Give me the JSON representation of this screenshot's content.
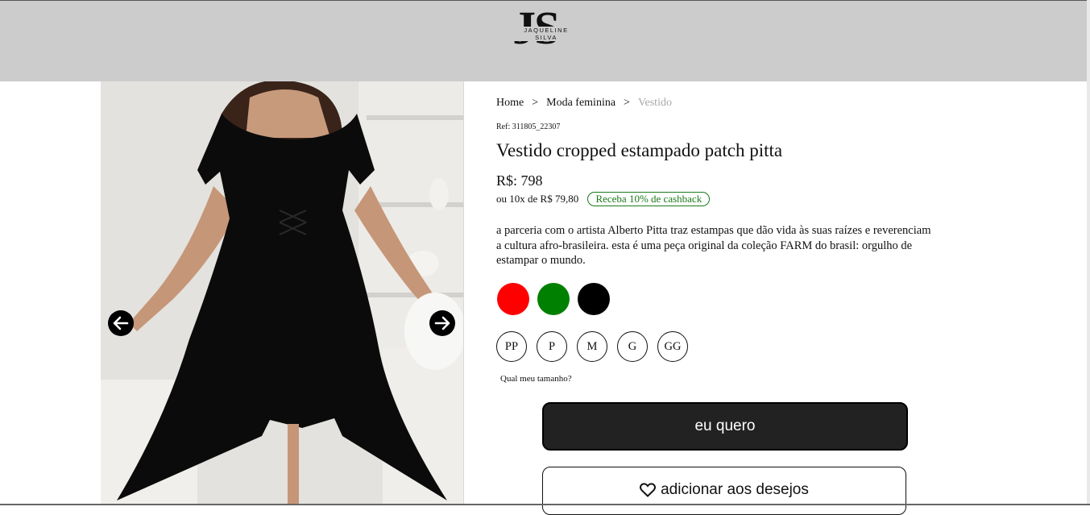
{
  "brand": {
    "logo_letters": "JS",
    "logo_name": "JAQUELINE SILVA"
  },
  "breadcrumb": {
    "items": [
      "Home",
      "Moda feminina",
      "Vestido"
    ],
    "separator": ">"
  },
  "product": {
    "ref": "Ref: 311805_22307",
    "title": "Vestido cropped estampado patch pitta",
    "price": "R$: 798",
    "installments": "ou 10x de R$ 79,80",
    "cashback_badge": "Receba 10% de cashback",
    "description": "a parceria com o artista Alberto Pitta traz estampas que dão vida às suas raízes e reverenciam a cultura afro-brasileira. esta é uma peça original da coleção FARM do brasil: orgulho de estampar o mundo.",
    "colors": [
      {
        "name": "red",
        "hex": "#ff0000"
      },
      {
        "name": "green",
        "hex": "#008000"
      },
      {
        "name": "black",
        "hex": "#000000"
      }
    ],
    "sizes": [
      "PP",
      "P",
      "M",
      "G",
      "GG"
    ],
    "size_guide": "Qual meu tamanho?"
  },
  "gallery": {
    "prev_icon": "arrow-left-icon",
    "next_icon": "arrow-right-icon"
  },
  "actions": {
    "buy_label": "eu quero",
    "wishlist_label": "adicionar aos desejos",
    "wishlist_icon": "heart-icon"
  }
}
